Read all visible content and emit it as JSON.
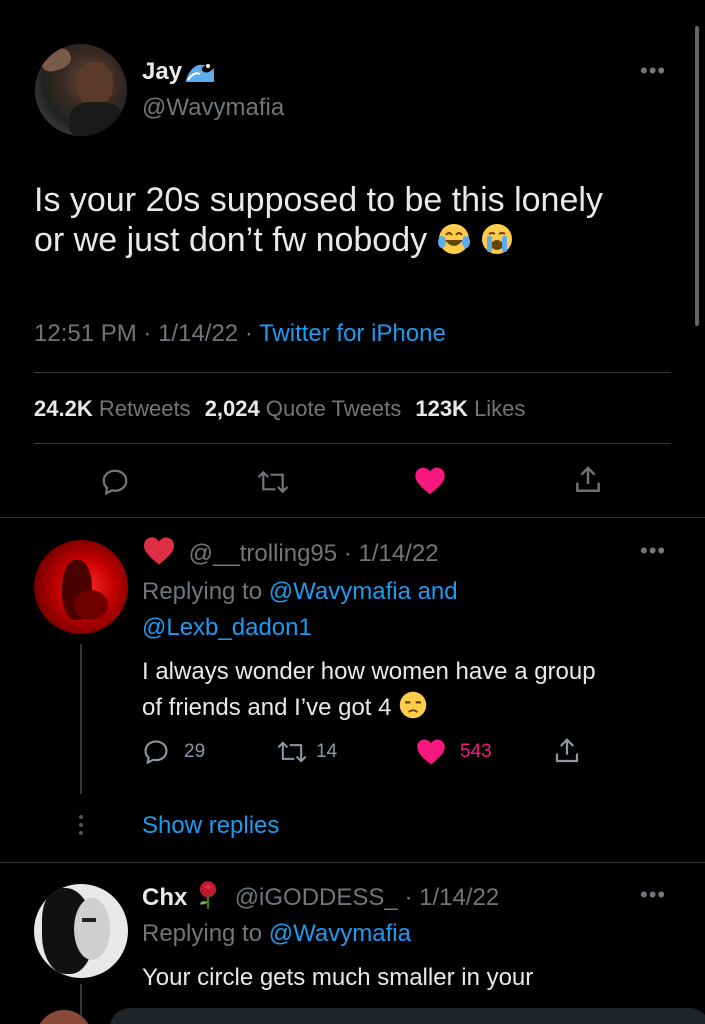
{
  "main_tweet": {
    "display_name": "Jay",
    "handle": "@Wavymafia",
    "text_line1": "Is your 20s supposed to be this lonely",
    "text_line2": "or we just don’t fw nobody",
    "time": "12:51 PM",
    "date": "1/14/22",
    "source": "Twitter for iPhone",
    "retweets_count": "24.2K",
    "retweets_label": "Retweets",
    "quotes_count": "2,024",
    "quotes_label": "Quote Tweets",
    "likes_count": "123K",
    "likes_label": "Likes"
  },
  "reply1": {
    "handle": "@__trolling95",
    "date": "1/14/22",
    "replying_prefix": "Replying to",
    "replying_to1": "@Wavymafia and",
    "replying_to2": "@Lexb_dadon1",
    "text_line1": "I always wonder how women have a group",
    "text_line2": "of friends and I’ve got 4",
    "replies": "29",
    "retweets": "14",
    "likes": "543",
    "show_replies": "Show replies"
  },
  "reply2": {
    "display_name": "Chx",
    "handle": "@iGODDESS_",
    "date": "1/14/22",
    "replying_prefix": "Replying to",
    "replying_to": "@Wavymafia",
    "text_line1": "Your circle gets much smaller in your"
  },
  "colors": {
    "accent": "#1d9bf0",
    "like": "#f91880",
    "muted": "#71767b",
    "background": "#000000"
  }
}
